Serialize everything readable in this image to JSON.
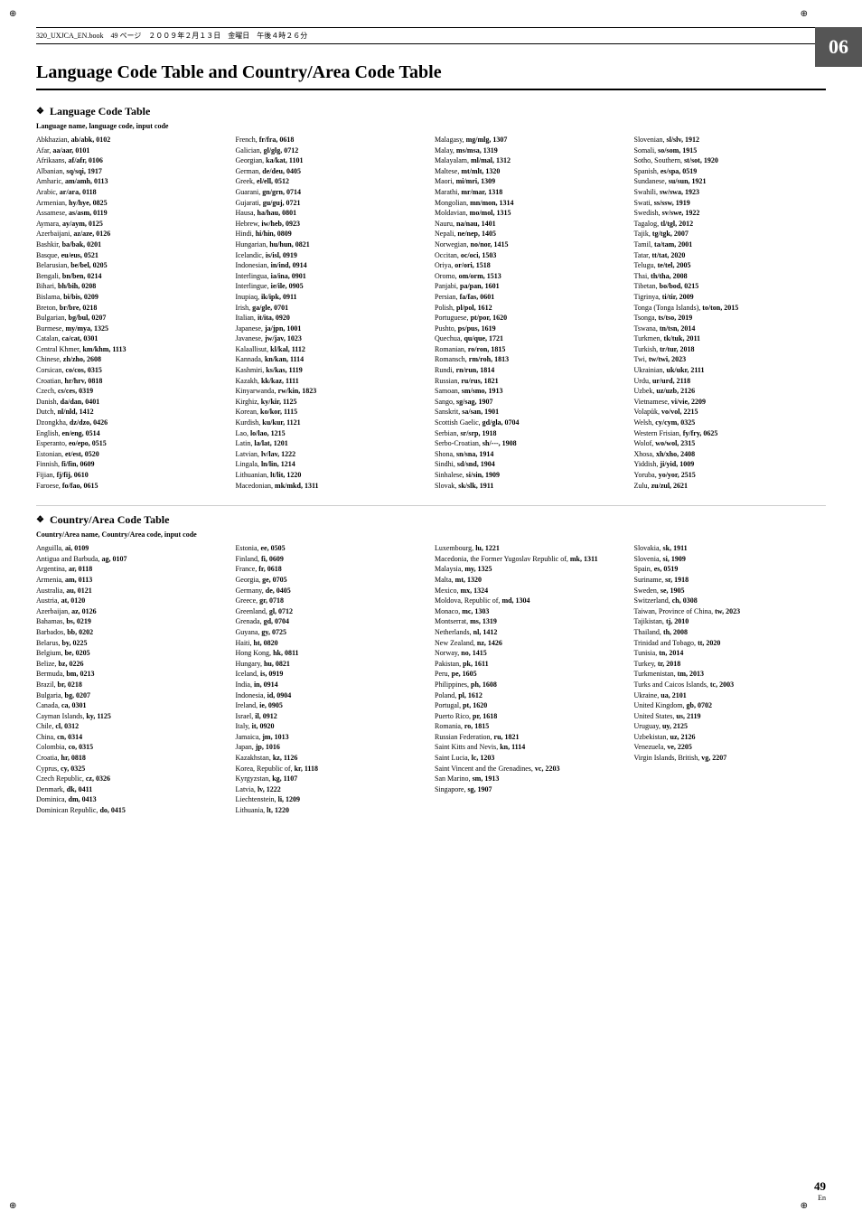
{
  "header": {
    "left": "320_UXJCA_EN.book　49 ページ　２００９年２月１３日　金曜日　午後４時２６分"
  },
  "chapter": "06",
  "page_number": "49",
  "page_lang": "En",
  "main_title": "Language Code Table and Country/Area Code Table",
  "language_section": {
    "heading": "Language Code Table",
    "desc_normal": "Language name, ",
    "desc_bold": "language code, input code",
    "columns": [
      [
        "Abkhazian, ab/abk, 0102",
        "Afar, aa/aar, 0101",
        "Afrikaans, af/afr, 0106",
        "Albanian, sq/sqi, 1917",
        "Amharic, am/amh, 0113",
        "Arabic, ar/ara, 0118",
        "Armenian, hy/hye, 0825",
        "Assamese, as/asm, 0119",
        "Aymara, ay/aym, 0125",
        "Azerbaijani, az/aze, 0126",
        "Bashkir, ba/bak, 0201",
        "Basque, eu/eus, 0521",
        "Belarusian, be/bel, 0205",
        "Bengali, bn/ben, 0214",
        "Bihari, bh/bih, 0208",
        "Bislama, bi/bis, 0209",
        "Breton, br/bre, 0218",
        "Bulgarian, bg/bul, 0207",
        "Burmese, my/mya, 1325",
        "Catalan, ca/cat, 0301",
        "Central Khmer, km/khm, 1113",
        "Chinese, zh/zho, 2608",
        "Corsican, co/cos, 0315",
        "Croatian, hr/hrv, 0818",
        "Czech, cs/ces, 0319",
        "Danish, da/dan, 0401",
        "Dutch, nl/nld, 1412",
        "Dzongkha, dz/dzo, 0426",
        "English, en/eng, 0514",
        "Esperanto, eo/epo, 0515",
        "Estonian, et/est, 0520",
        "Finnish, fi/fin, 0609",
        "Fijian, fj/fij, 0610",
        "Faroese, fo/fao, 0615"
      ],
      [
        "French, fr/fra, 0618",
        "Galician, gl/glg, 0712",
        "Georgian, ka/kat, 1101",
        "German, de/deu, 0405",
        "Greek, el/ell, 0512",
        "Guarani, gn/grn, 0714",
        "Gujarati, gu/guj, 0721",
        "Hausa, ha/hau, 0801",
        "Hebrew, iw/heb, 0923",
        "Hindi, hi/hin, 0809",
        "Hungarian, hu/hun, 0821",
        "Icelandic, is/isl, 0919",
        "Indonesian, in/ind, 0914",
        "Interlingua, ia/ina, 0901",
        "Interlingue, ie/ile, 0905",
        "Inupiaq, ik/ipk, 0911",
        "Irish, ga/gle, 0701",
        "Italian, it/ita, 0920",
        "Japanese, ja/jpn, 1001",
        "Javanese, jw/jav, 1023",
        "Kalaallisut, kl/kal, 1112",
        "Kannada, kn/kan, 1114",
        "Kashmiri, ks/kas, 1119",
        "Kazakh, kk/kaz, 1111",
        "Kinyarwanda, rw/kin, 1823",
        "Kirghiz, ky/kir, 1125",
        "Korean, ko/kor, 1115",
        "Kurdish, ku/kur, 1121",
        "Lao, lo/lao, 1215",
        "Latin, la/lat, 1201",
        "Latvian, lv/lav, 1222",
        "Lingala, ln/lin, 1214",
        "Lithuanian, lt/lit, 1220",
        "Macedonian, mk/mkd, 1311"
      ],
      [
        "Malagasy, mg/mlg, 1307",
        "Malay, ms/msa, 1319",
        "Malayalam, ml/mal, 1312",
        "Maltese, mt/mlt, 1320",
        "Maori, mi/mri, 1309",
        "Marathi, mr/mar, 1318",
        "Mongolian, mn/mon, 1314",
        "Moldavian, mo/mol, 1315",
        "Nauru, na/nau, 1401",
        "Nepali, ne/nep, 1405",
        "Norwegian, no/nor, 1415",
        "Occitan, oc/oci, 1503",
        "Oriya, or/ori, 1518",
        "Oromo, om/orm, 1513",
        "Panjabi, pa/pan, 1601",
        "Persian, fa/fas, 0601",
        "Polish, pl/pol, 1612",
        "Portuguese, pt/por, 1620",
        "Pushto, ps/pus, 1619",
        "Quechua, qu/que, 1721",
        "Romanian, ro/ron, 1815",
        "Romansch, rm/roh, 1813",
        "Rundi, rn/run, 1814",
        "Russian, ru/rus, 1821",
        "Samoan, sm/smo, 1913",
        "Sango, sg/sag, 1907",
        "Sanskrit, sa/san, 1901",
        "Scottish Gaelic, gd/gla, 0704",
        "Serbian, sr/srp, 1918",
        "Serbo-Croatian, sh/---, 1908",
        "Shona, sn/sna, 1914",
        "Sindhi, sd/snd, 1904",
        "Sinhalese, si/sin, 1909",
        "Slovak, sk/slk, 1911"
      ],
      [
        "Slovenian, sl/slv, 1912",
        "Somali, so/som, 1915",
        "Sotho, Southern, st/sot, 1920",
        "Spanish, es/spa, 0519",
        "Sundanese, su/sun, 1921",
        "Swahili, sw/swa, 1923",
        "Swati, ss/ssw, 1919",
        "Swedish, sv/swe, 1922",
        "Tagalog, tl/tgl, 2012",
        "Tajik, tg/tgk, 2007",
        "Tamil, ta/tam, 2001",
        "Tatar, tt/tat, 2020",
        "Telugu, te/tel, 2005",
        "Thai, th/tha, 2008",
        "Tibetan, bo/bod, 0215",
        "Tigrinya, ti/tir, 2009",
        "Tonga (Tonga Islands), to/ton, 2015",
        "Tsonga, ts/tso, 2019",
        "Tswana, tn/tsn, 2014",
        "Turkmen, tk/tuk, 2011",
        "Turkish, tr/tur, 2018",
        "Twi, tw/twi, 2023",
        "Ukrainian, uk/ukr, 2111",
        "Urdu, ur/urd, 2118",
        "Uzbek, uz/uzb, 2126",
        "Vietnamese, vi/vie, 2209",
        "Volapük, vo/vol, 2215",
        "Welsh, cy/cym, 0325",
        "Western Frisian, fy/fry, 0625",
        "Wolof, wo/wol, 2315",
        "Xhosa, xh/xho, 2408",
        "Yiddish, ji/yid, 1009",
        "Yoruba, yo/yor, 2515",
        "Zulu, zu/zul, 2621"
      ]
    ]
  },
  "country_section": {
    "heading": "Country/Area Code Table",
    "desc_normal": "Country/Area name, ",
    "desc_bold": "Country/Area code, input code",
    "columns": [
      [
        "Anguilla, ai, 0109",
        "Antigua and Barbuda, ag, 0107",
        "Argentina, ar, 0118",
        "Armenia, am, 0113",
        "Australia, au, 0121",
        "Austria, at, 0120",
        "Azerbaijan, az, 0126",
        "Bahamas, bs, 0219",
        "Barbados, bb, 0202",
        "Belarus, by, 0225",
        "Belgium, be, 0205",
        "Belize, bz, 0226",
        "Bermuda, bm, 0213",
        "Brazil, br, 0218",
        "Bulgaria, bg, 0207",
        "Canada, ca, 0301",
        "Cayman Islands, ky, 1125",
        "Chile, cl, 0312",
        "China, cn, 0314",
        "Colombia, co, 0315",
        "Croatia, hr, 0818",
        "Cyprus, cy, 0325",
        "Czech Republic, cz, 0326",
        "Denmark, dk, 0411",
        "Dominica, dm, 0413",
        "Dominican Republic, do, 0415"
      ],
      [
        "Estonia, ee, 0505",
        "Finland, fi, 0609",
        "France, fr, 0618",
        "Georgia, ge, 0705",
        "Germany, de, 0405",
        "Greece, gr, 0718",
        "Greenland, gl, 0712",
        "Grenada, gd, 0704",
        "Guyana, gy, 0725",
        "Haiti, ht, 0820",
        "Hong Kong, hk, 0811",
        "Hungary, hu, 0821",
        "Iceland, is, 0919",
        "India, in, 0914",
        "Indonesia, id, 0904",
        "Ireland, ie, 0905",
        "Israel, il, 0912",
        "Italy, it, 0920",
        "Jamaica, jm, 1013",
        "Japan, jp, 1016",
        "Kazakhstan, kz, 1126",
        "Korea, Republic of, kr, 1118",
        "Kyrgyzstan, kg, 1107",
        "Latvia, lv, 1222",
        "Liechtenstein, li, 1209",
        "Lithuania, lt, 1220"
      ],
      [
        "Luxembourg, lu, 1221",
        "Macedonia, the Former Yugoslav Republic of, mk, 1311",
        "Malaysia, my, 1325",
        "Malta, mt, 1320",
        "Mexico, mx, 1324",
        "Moldova, Republic of, md, 1304",
        "Monaco, mc, 1303",
        "Montserrat, ms, 1319",
        "Netherlands, nl, 1412",
        "New Zealand, nz, 1426",
        "Norway, no, 1415",
        "Pakistan, pk, 1611",
        "Peru, pe, 1605",
        "Philippines, ph, 1608",
        "Poland, pl, 1612",
        "Portugal, pt, 1620",
        "Puerto Rico, pr, 1618",
        "Romania, ro, 1815",
        "Russian Federation, ru, 1821",
        "Saint Kitts and Nevis, kn, 1114",
        "Saint Lucia, lc, 1203",
        "Saint Vincent and the Grenadines, vc, 2203",
        "San Marino, sm, 1913",
        "Singapore, sg, 1907"
      ],
      [
        "Slovakia, sk, 1911",
        "Slovenia, si, 1909",
        "Spain, es, 0519",
        "Suriname, sr, 1918",
        "Sweden, se, 1905",
        "Switzerland, ch, 0308",
        "Taiwan, Province of China, tw, 2023",
        "Tajikistan, tj, 2010",
        "Thailand, th, 2008",
        "Trinidad and Tobago, tt, 2020",
        "Tunisia, tn, 2014",
        "Turkey, tr, 2018",
        "Turkmenistan, tm, 2013",
        "Turks and Caicos Islands, tc, 2003",
        "Ukraine, ua, 2101",
        "United Kingdom, gb, 0702",
        "United States, us, 2119",
        "Uruguay, uy, 2125",
        "Uzbekistan, uz, 2126",
        "Venezuela, ve, 2205",
        "Virgin Islands, British, vg, 2207"
      ]
    ]
  }
}
